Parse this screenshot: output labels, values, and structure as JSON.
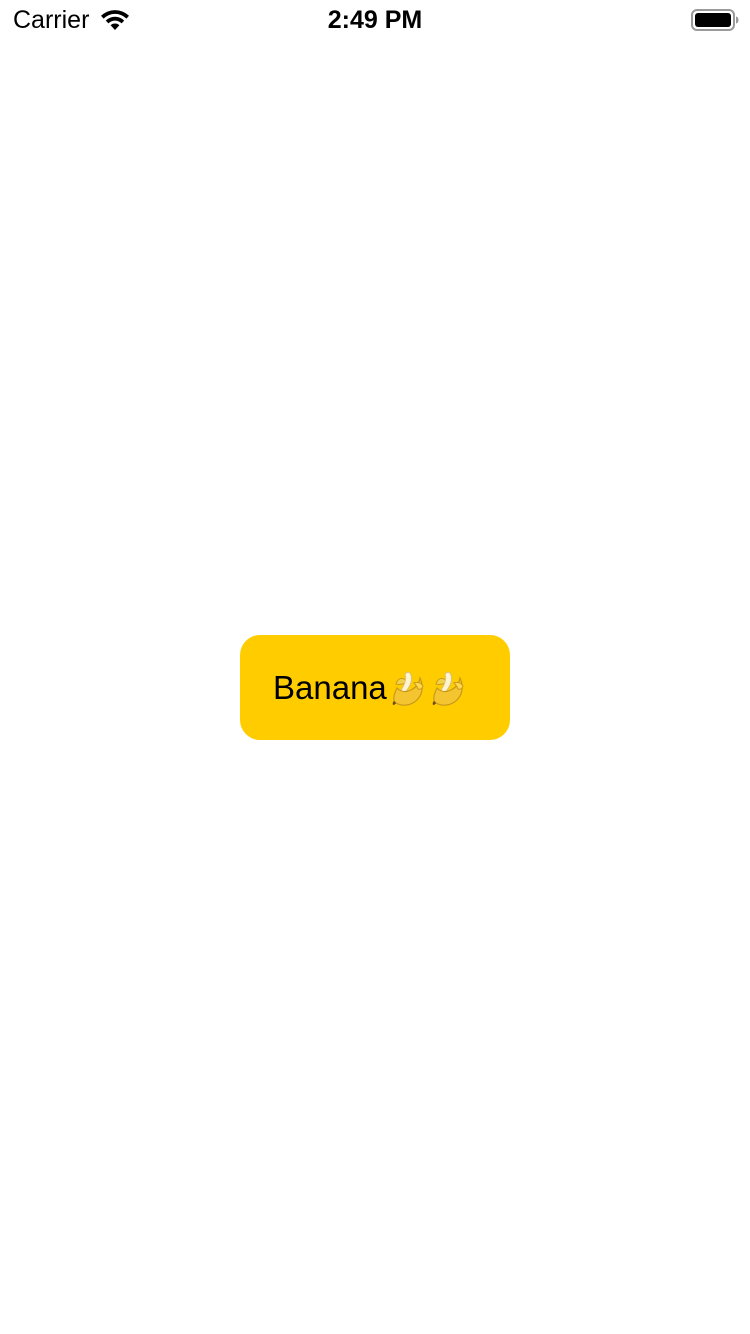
{
  "status_bar": {
    "carrier": "Carrier",
    "time": "2:49 PM",
    "wifi_icon": "wifi-icon",
    "battery_icon": "battery-icon"
  },
  "main": {
    "button": {
      "label": "Banana",
      "icons": [
        "banana-icon",
        "banana-icon"
      ],
      "background_color": "#ffcc00",
      "text_color": "#000000"
    }
  }
}
